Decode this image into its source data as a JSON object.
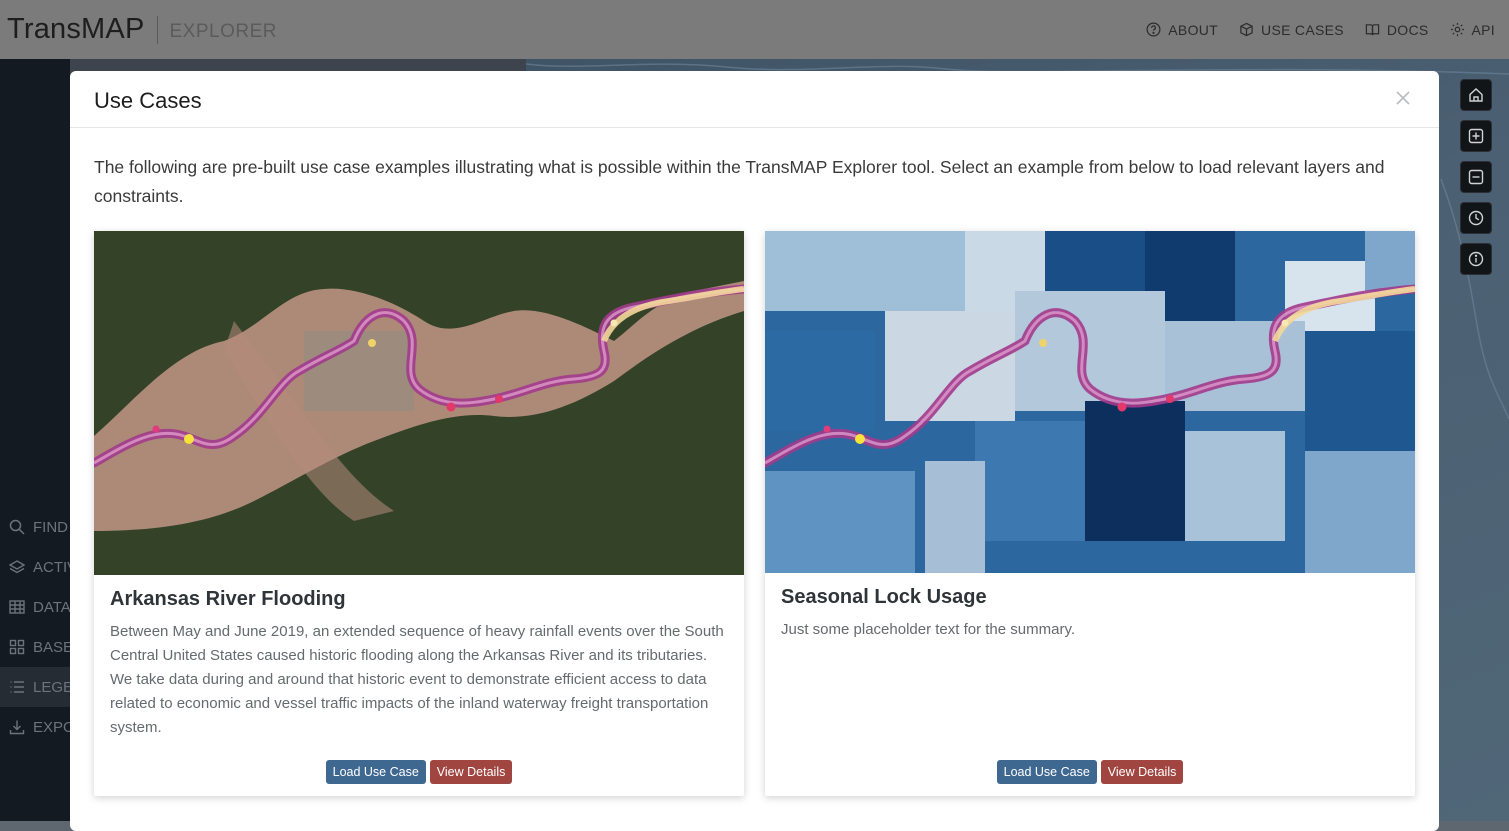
{
  "app": {
    "title": "TransMAP",
    "subtitle": "EXPLORER"
  },
  "nav": {
    "items": [
      {
        "label": "ABOUT",
        "icon": "help-circle-icon"
      },
      {
        "label": "USE CASES",
        "icon": "cube-icon"
      },
      {
        "label": "DOCS",
        "icon": "book-icon"
      },
      {
        "label": "API",
        "icon": "gear-icon"
      }
    ]
  },
  "sidebar": {
    "items": [
      {
        "label": "FIND",
        "icon": "search-icon"
      },
      {
        "label": "ACTIVE",
        "icon": "layers-icon"
      },
      {
        "label": "DATA",
        "icon": "table-icon"
      },
      {
        "label": "BASE",
        "icon": "grid-icon"
      },
      {
        "label": "LEGEND",
        "icon": "list-icon",
        "active": true
      },
      {
        "label": "EXPORT",
        "icon": "download-icon"
      }
    ]
  },
  "map_tools": [
    "home-icon",
    "zoom-in-icon",
    "zoom-out-icon",
    "clock-icon",
    "info-icon"
  ],
  "modal": {
    "title": "Use Cases",
    "intro": "The following are pre-built use case examples illustrating what is possible within the TransMAP Explorer tool. Select an example from below to load relevant layers and constraints.",
    "cards": [
      {
        "title": "Arkansas River Flooding",
        "text": "Between May and June 2019, an extended sequence of heavy rainfall events over the South Central United States caused historic flooding along the Arkansas River and its tributaries. We take data during and around that historic event to demonstrate efficient access to data related to economic and vessel traffic impacts of the inland waterway freight transportation system.",
        "load_label": "Load Use Case",
        "view_label": "View Details"
      },
      {
        "title": "Seasonal Lock Usage",
        "text": "Just some placeholder text for the summary.",
        "load_label": "Load Use Case",
        "view_label": "View Details"
      }
    ]
  },
  "colors": {
    "load_button": "#3f6890",
    "view_button": "#a0453f",
    "sidebar_bg": "#141a21",
    "topbar_bg": "#7b7b7b"
  }
}
